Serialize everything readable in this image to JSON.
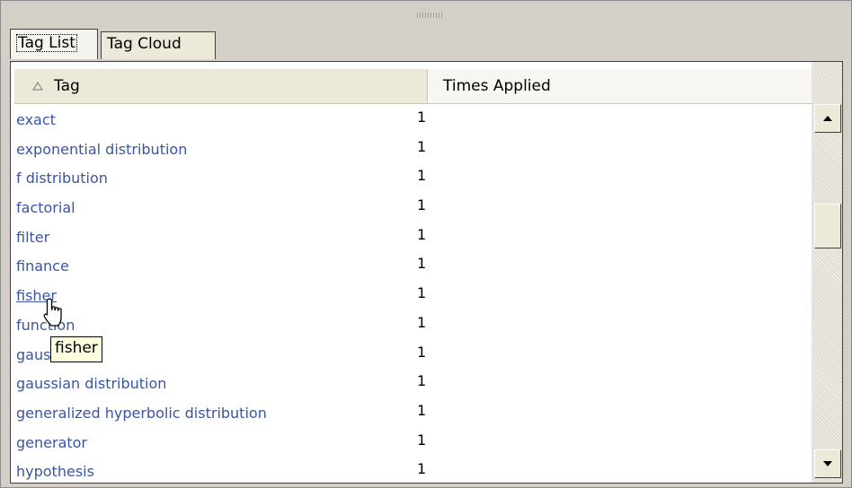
{
  "tabs": [
    {
      "label": "Tag List",
      "active": true
    },
    {
      "label": "Tag Cloud",
      "active": false
    }
  ],
  "table": {
    "columns": {
      "tag": "Tag",
      "times_applied": "Times Applied"
    },
    "sort_indicator_icon": "sort-ascending-icon",
    "rows": [
      {
        "tag": "exact",
        "count": "1"
      },
      {
        "tag": "exponential distribution",
        "count": "1"
      },
      {
        "tag": "f distribution",
        "count": "1"
      },
      {
        "tag": "factorial",
        "count": "1"
      },
      {
        "tag": "filter",
        "count": "1"
      },
      {
        "tag": "finance",
        "count": "1"
      },
      {
        "tag": "fisher",
        "count": "1"
      },
      {
        "tag": "function",
        "count": "1"
      },
      {
        "tag": "gaussian",
        "count": "1"
      },
      {
        "tag": "gaussian distribution",
        "count": "1"
      },
      {
        "tag": "generalized hyperbolic distribution",
        "count": "1"
      },
      {
        "tag": "generator",
        "count": "1"
      },
      {
        "tag": "hypothesis",
        "count": "1"
      }
    ],
    "link_color": "#3a55a4"
  },
  "tooltip": {
    "text": "fisher"
  },
  "scrollbar": {
    "up_icon": "scroll-up-arrow-icon",
    "down_icon": "scroll-down-arrow-icon"
  },
  "cursor_icon": "hand-pointer-icon"
}
